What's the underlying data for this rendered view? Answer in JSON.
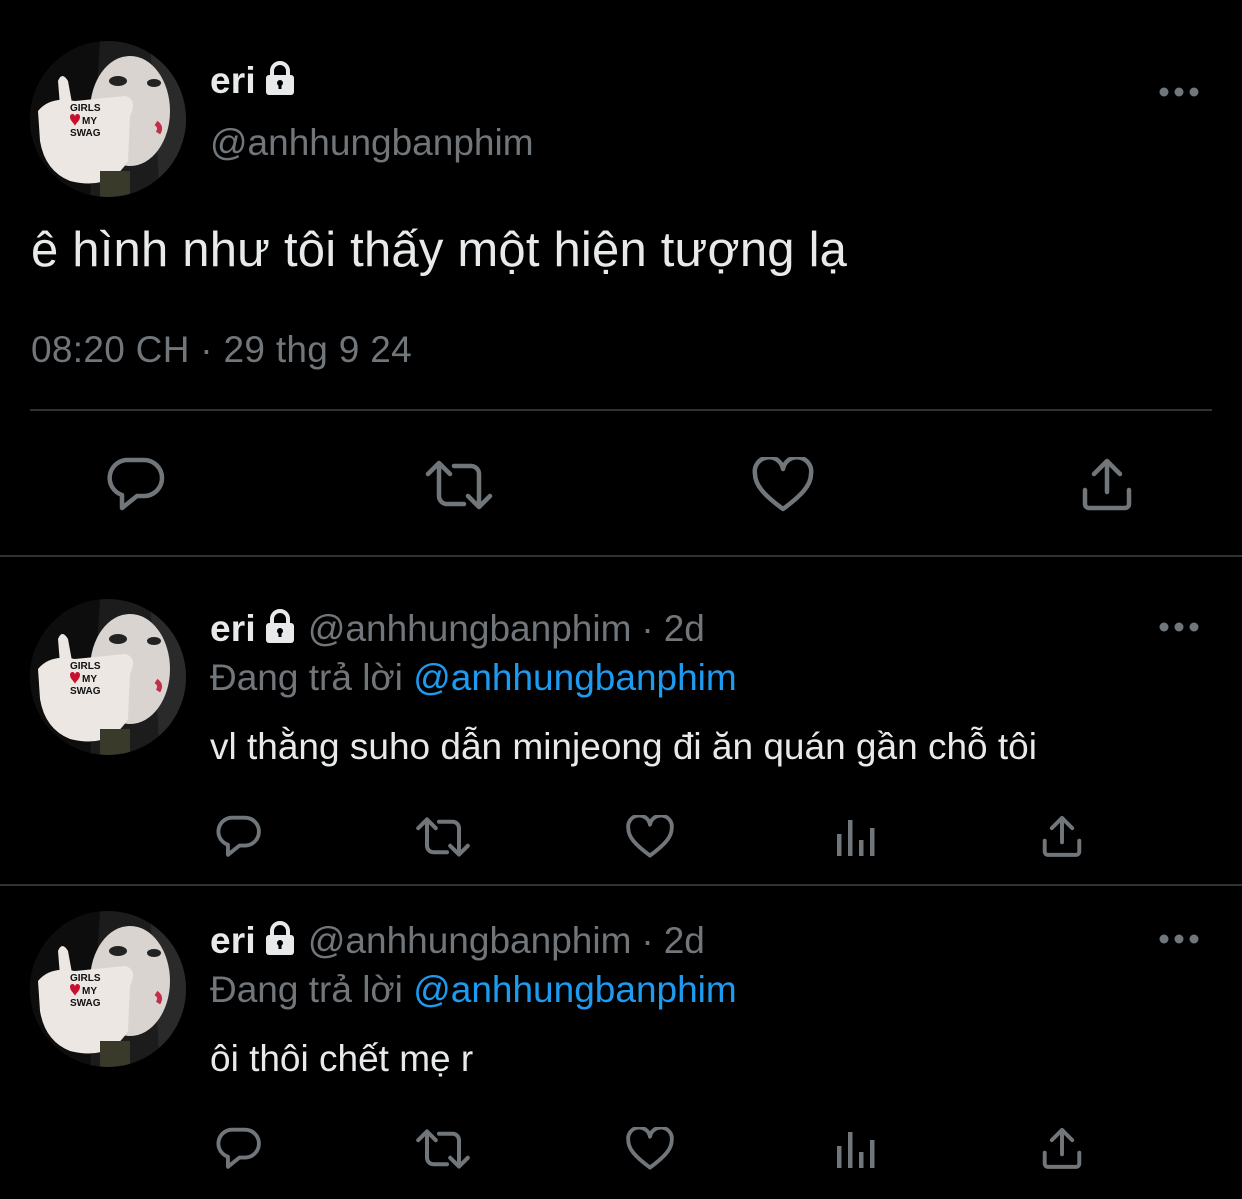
{
  "main_tweet": {
    "display_name": "eri",
    "handle": "@anhhungbanphim",
    "text": "ê hình như tôi thấy một hiện tượng lạ",
    "timestamp": "08:20 CH · 29 thg 9 24",
    "avatar_text": [
      "GIRLS",
      "MY",
      "SWAG"
    ],
    "actions": [
      "reply-icon",
      "retweet-icon",
      "like-icon",
      "share-icon"
    ]
  },
  "replies": [
    {
      "display_name": "eri",
      "handle": "@anhhungbanphim",
      "separator": "·",
      "time": "2d",
      "replying_prefix": "Đang trả lời",
      "replying_to": "@anhhungbanphim",
      "text": "vl thằng suho dẫn minjeong đi ăn quán gần chỗ tôi"
    },
    {
      "display_name": "eri",
      "handle": "@anhhungbanphim",
      "separator": "·",
      "time": "2d",
      "replying_prefix": "Đang trả lời",
      "replying_to": "@anhhungbanphim",
      "text": "ôi thôi chết mẹ r"
    }
  ],
  "colors": {
    "background": "#000000",
    "primary_text": "#e7e9ea",
    "secondary_text": "#71767b",
    "accent_link": "#1d9bf0",
    "divider": "#2f3336"
  }
}
